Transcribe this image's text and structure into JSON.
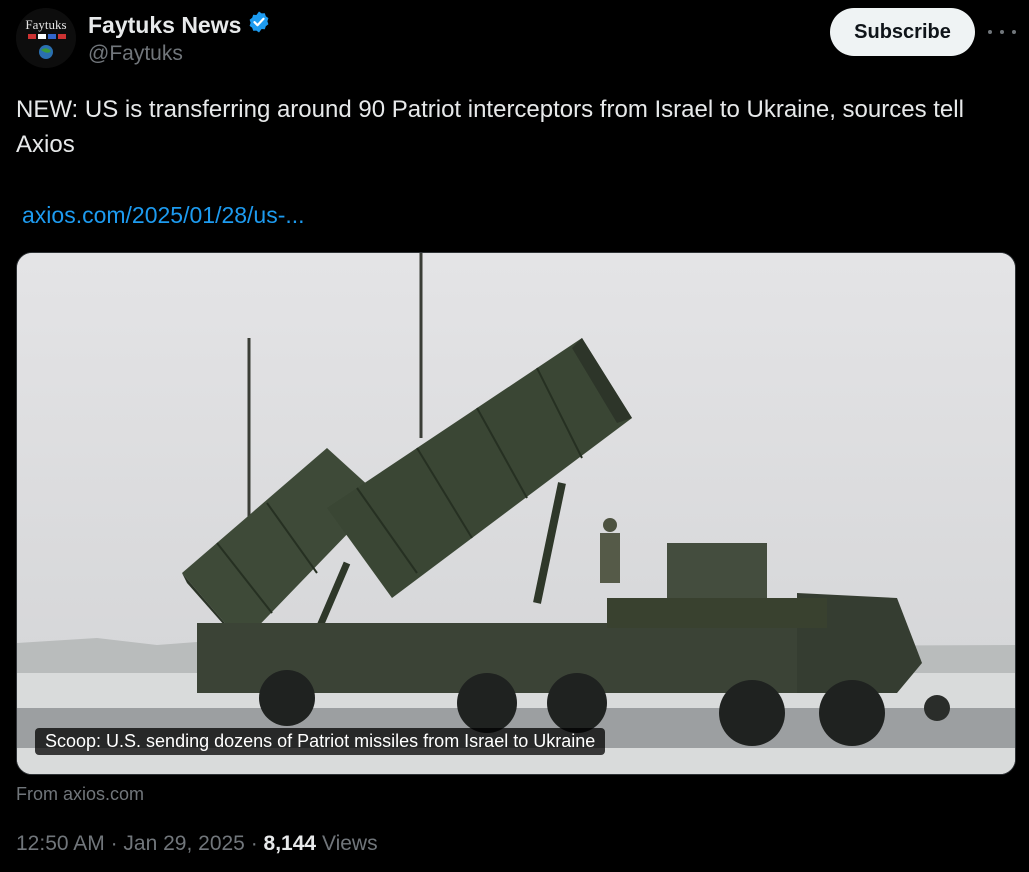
{
  "account": {
    "avatar_text": "Faytuks",
    "display_name": "Faytuks News",
    "handle": "@Faytuks",
    "verified_color": "#1d9bf0"
  },
  "actions": {
    "subscribe_label": "Subscribe",
    "more_icon": "more-horizontal-icon"
  },
  "tweet": {
    "text": "NEW: US is transferring around 90 Patriot interceptors from Israel to Ukraine, sources tell Axios",
    "link_text": "axios.com/2025/01/28/us-..."
  },
  "card": {
    "image_subject": "patriot-launcher-snow-photo",
    "title": "Scoop: U.S. sending dozens of Patriot missiles from Israel to Ukraine",
    "source": "From axios.com"
  },
  "meta": {
    "time": "12:50 AM",
    "separator": "·",
    "date": "Jan 29, 2025",
    "views_count": "8,144",
    "views_label": "Views"
  },
  "colors": {
    "background": "#000000",
    "text_primary": "#e7e9ea",
    "text_secondary": "#71767b",
    "link": "#1d9bf0"
  }
}
